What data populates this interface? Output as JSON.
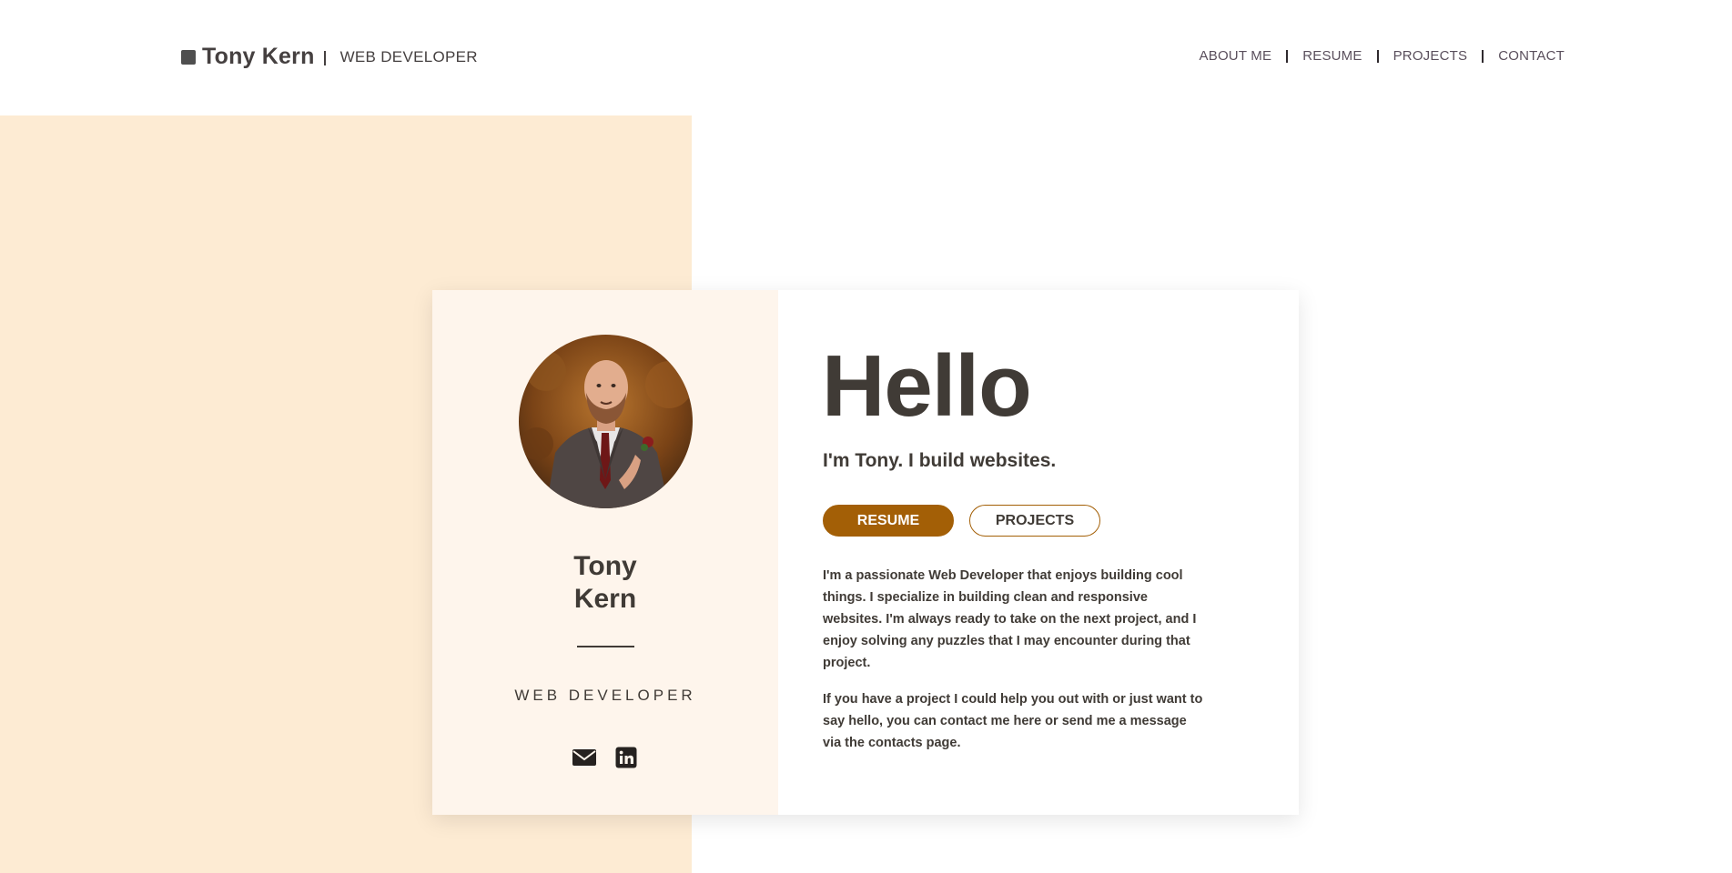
{
  "header": {
    "name": "Tony Kern",
    "role": "WEB DEVELOPER",
    "nav": [
      "ABOUT ME",
      "RESUME",
      "PROJECTS",
      "CONTACT"
    ]
  },
  "profile": {
    "first_name": "Tony",
    "last_name": "Kern",
    "role": "WEB DEVELOPER",
    "socials": [
      "email-icon",
      "linkedin-icon"
    ]
  },
  "intro": {
    "heading": "Hello",
    "tagline": "I'm Tony. I build websites.",
    "resume_button": "RESUME",
    "projects_button": "PROJECTS",
    "bio": [
      "I'm a passionate Web Developer that enjoys building cool things. I specialize in building clean and responsive websites. I'm always ready to take on the next project, and I enjoy solving any puzzles that I may encounter during that project.",
      "If you have a project I could help you out with or just want to say hello, you can contact me here or send me a message via the contacts page."
    ]
  },
  "colors": {
    "accent": "#a35f06",
    "peach_background": "#fdebd3",
    "card_left": "#fef5ec",
    "text": "#403b36"
  }
}
